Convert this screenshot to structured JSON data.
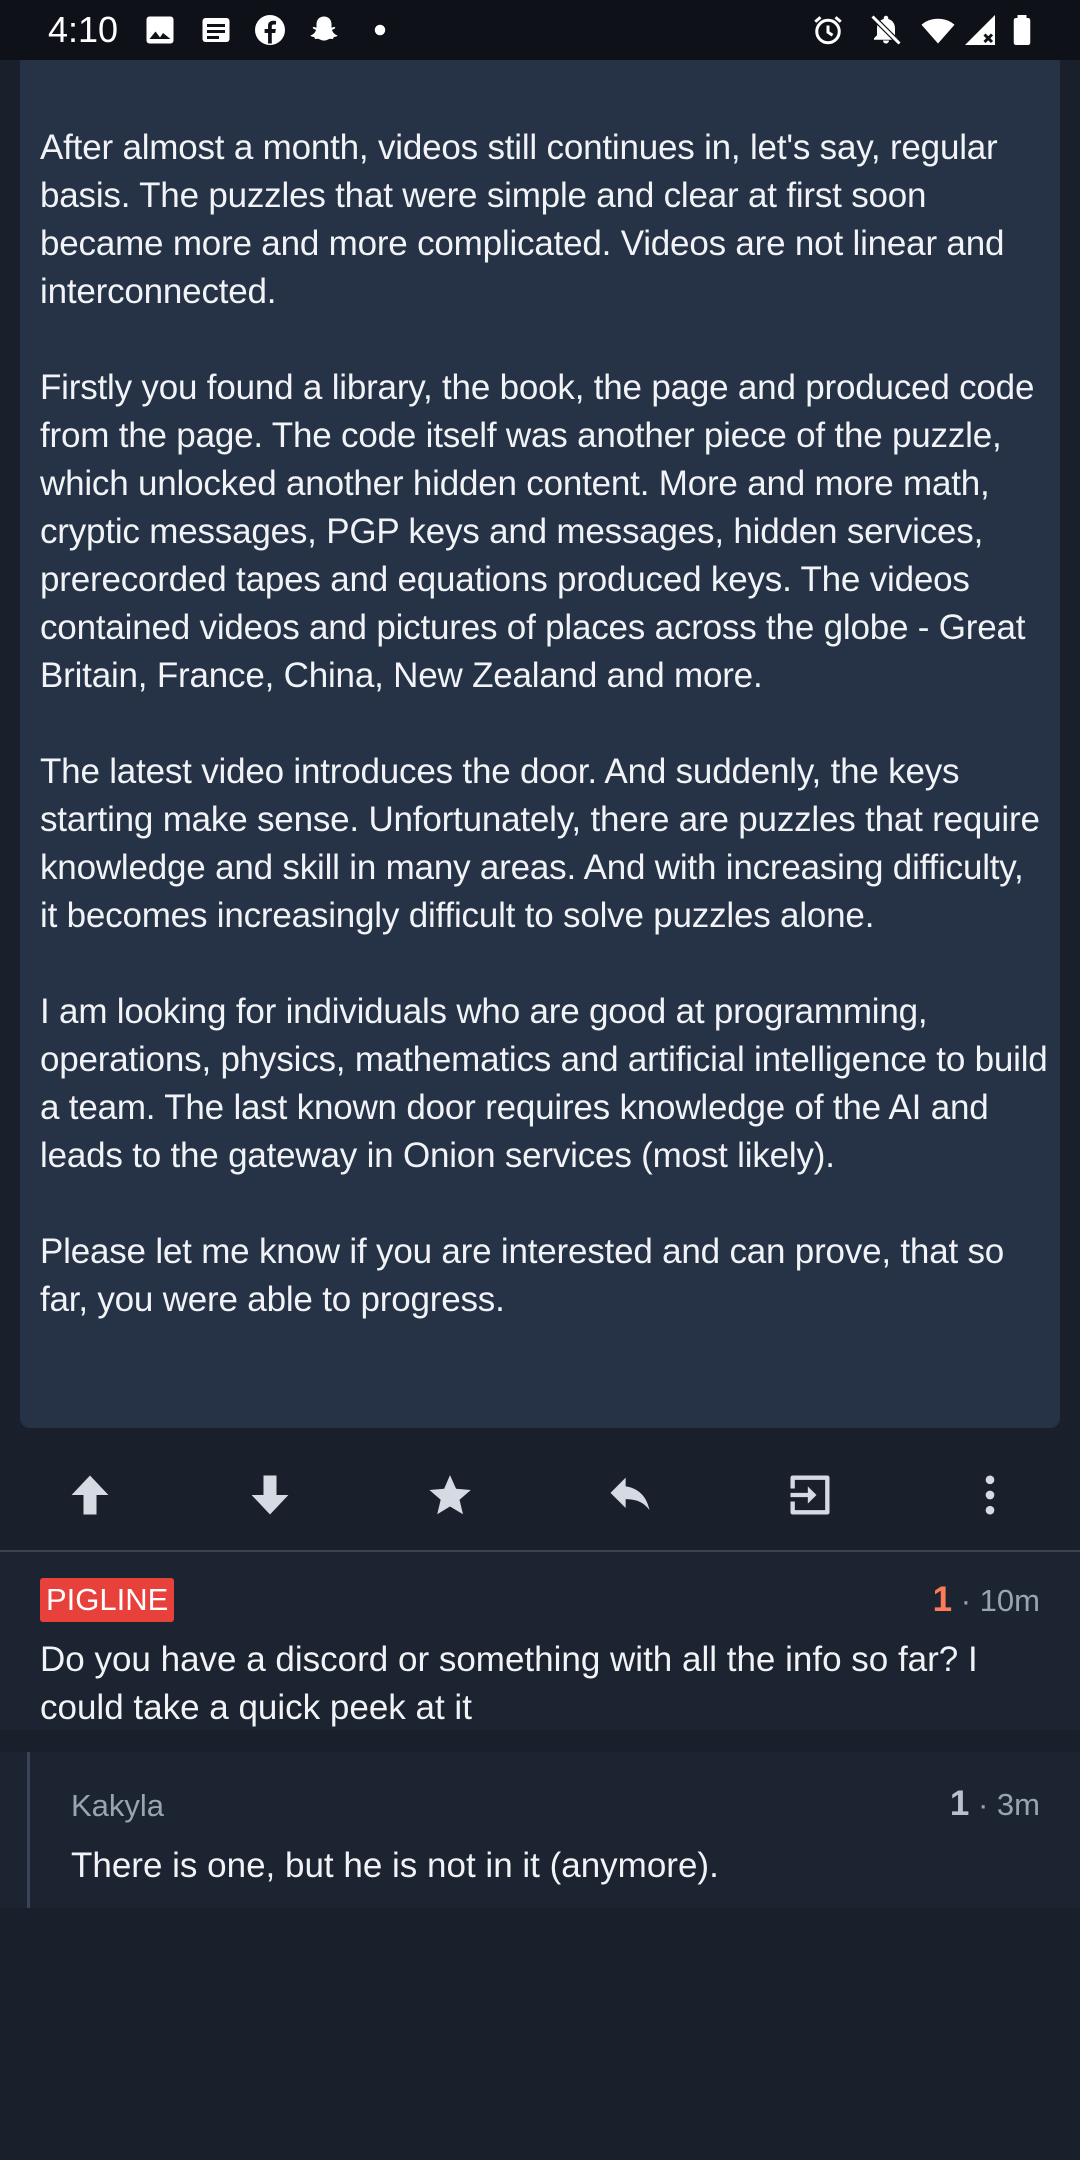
{
  "status_bar": {
    "time": "4:10",
    "left_icons": [
      "gallery-icon",
      "news-icon",
      "facebook-icon",
      "snapchat-icon",
      "dot-icon"
    ],
    "right_icons": [
      "alarm-icon",
      "notifications-off-icon",
      "wifi-icon",
      "signal-icon",
      "battery-icon"
    ]
  },
  "post": {
    "paragraphs": [
      "After almost a month, videos still continues in, let's say, regular basis. The puzzles that were simple and clear at first soon became more and more complicated. Videos are not linear and interconnected.",
      "Firstly you found a library, the book, the page and produced code from the page. The code itself was another piece of the puzzle, which unlocked another hidden content. More and more math, cryptic messages, PGP keys and messages, hidden services, prerecorded tapes and equations produced keys. The videos contained videos and pictures of places across the globe - Great Britain, France, China, New Zealand and more.",
      "The latest video introduces the door. And suddenly, the keys starting make sense. Unfortunately, there are puzzles that require knowledge and skill in many areas. And with increasing difficulty, it becomes increasingly difficult to solve puzzles alone.",
      "I am looking for individuals who are good at programming, operations, physics, mathematics and artificial intelligence to build a team. The last known door requires knowledge of the AI and leads to the gateway in Onion services (most likely).",
      "Please let me know if you are interested and can prove, that so far, you were able to progress."
    ]
  },
  "actions": [
    "upvote-icon",
    "downvote-icon",
    "star-icon",
    "reply-icon",
    "open-icon",
    "more-icon"
  ],
  "comments": [
    {
      "author": "PIGLINE",
      "score": "1",
      "age": "· 10m",
      "text": "Do you have a discord or something with all the info so far? I could take a quick peek at it"
    },
    {
      "author": "Kakyla",
      "score": "1",
      "age": "· 3m",
      "text": "There is one, but he is not in it (anymore)."
    }
  ],
  "colors": {
    "background": "#19202b",
    "post_card": "#263347",
    "op_badge": "#e8413c",
    "score_accent": "#ff7a57"
  }
}
